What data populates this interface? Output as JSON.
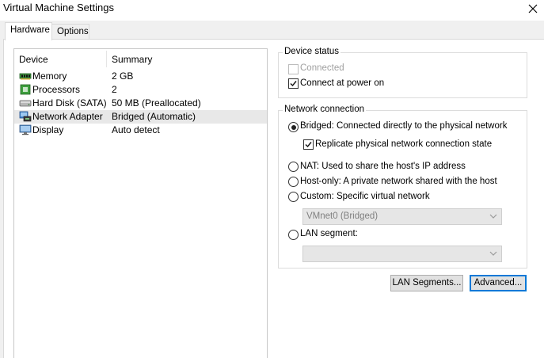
{
  "window": {
    "title": "Virtual Machine Settings"
  },
  "tabs": [
    {
      "label": "Hardware",
      "active": true
    },
    {
      "label": "Options",
      "active": false
    }
  ],
  "device_list": {
    "headers": {
      "device": "Device",
      "summary": "Summary"
    },
    "rows": [
      {
        "device": "Memory",
        "summary": "2 GB",
        "icon": "memory-icon",
        "selected": false
      },
      {
        "device": "Processors",
        "summary": "2",
        "icon": "processor-icon",
        "selected": false
      },
      {
        "device": "Hard Disk (SATA)",
        "summary": "50 MB (Preallocated)",
        "icon": "hard-disk-icon",
        "selected": false
      },
      {
        "device": "Network Adapter",
        "summary": "Bridged (Automatic)",
        "icon": "network-adapter-icon",
        "selected": true
      },
      {
        "device": "Display",
        "summary": "Auto detect",
        "icon": "display-icon",
        "selected": false
      }
    ]
  },
  "device_status": {
    "title": "Device status",
    "connected": {
      "label": "Connected",
      "checked": false,
      "enabled": false
    },
    "connect_at_power_on": {
      "label": "Connect at power on",
      "checked": true,
      "enabled": true
    }
  },
  "network_connection": {
    "title": "Network connection",
    "bridged": {
      "label": "Bridged: Connected directly to the physical network",
      "selected": true
    },
    "replicate": {
      "label": "Replicate physical network connection state",
      "checked": true
    },
    "nat": {
      "label": "NAT: Used to share the host's IP address",
      "selected": false
    },
    "host_only": {
      "label": "Host-only: A private network shared with the host",
      "selected": false
    },
    "custom": {
      "label": "Custom: Specific virtual network",
      "selected": false
    },
    "custom_select": {
      "value": "VMnet0 (Bridged)",
      "enabled": false
    },
    "lan_segment": {
      "label": "LAN segment:",
      "selected": false
    },
    "lan_select": {
      "value": "",
      "enabled": false
    }
  },
  "buttons": {
    "lan_segments": "LAN Segments...",
    "advanced": "Advanced..."
  },
  "colors": {
    "selected_row": "#e8e8e8",
    "default_button_border": "#0078d7",
    "disabled_text": "#a0a0a0"
  }
}
